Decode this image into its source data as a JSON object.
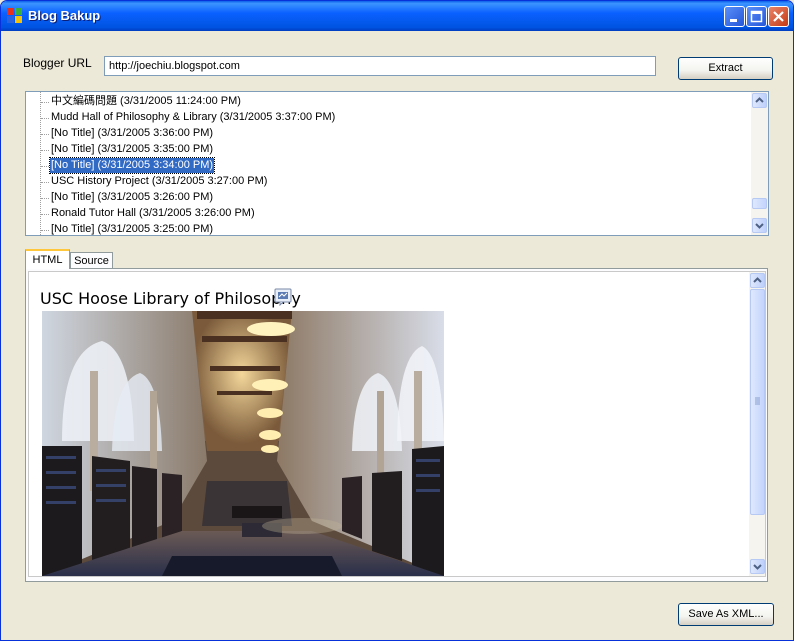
{
  "window": {
    "title": "Blog Bakup"
  },
  "form": {
    "url_label": "Blogger URL",
    "url_value": "http://joechiu.blogspot.com",
    "extract_label": "Extract",
    "save_label": "Save As XML..."
  },
  "posts": [
    "中文編碼問題 (3/31/2005 11:24:00 PM)",
    "Mudd Hall of Philosophy & Library (3/31/2005 3:37:00 PM)",
    "[No Title] (3/31/2005 3:36:00 PM)",
    "[No Title] (3/31/2005 3:35:00 PM)",
    "[No Title] (3/31/2005 3:34:00 PM)",
    "USC History Project (3/31/2005 3:27:00 PM)",
    "[No Title] (3/31/2005 3:26:00 PM)",
    "Ronald Tutor Hall (3/31/2005 3:26:00 PM)",
    "[No Title] (3/31/2005 3:25:00 PM)"
  ],
  "selected_index": 4,
  "tabs": [
    "HTML",
    "Source"
  ],
  "active_tab": "HTML",
  "preview": {
    "post_title": "USC Hoose Library of Philosophy",
    "image_subject": "library reading room photo",
    "comment_icon": "speech-bubble-icon"
  },
  "colors": {
    "titlebar": "#0058ee",
    "selection": "#316ac5",
    "tab_highlight": "#ffc83c"
  }
}
